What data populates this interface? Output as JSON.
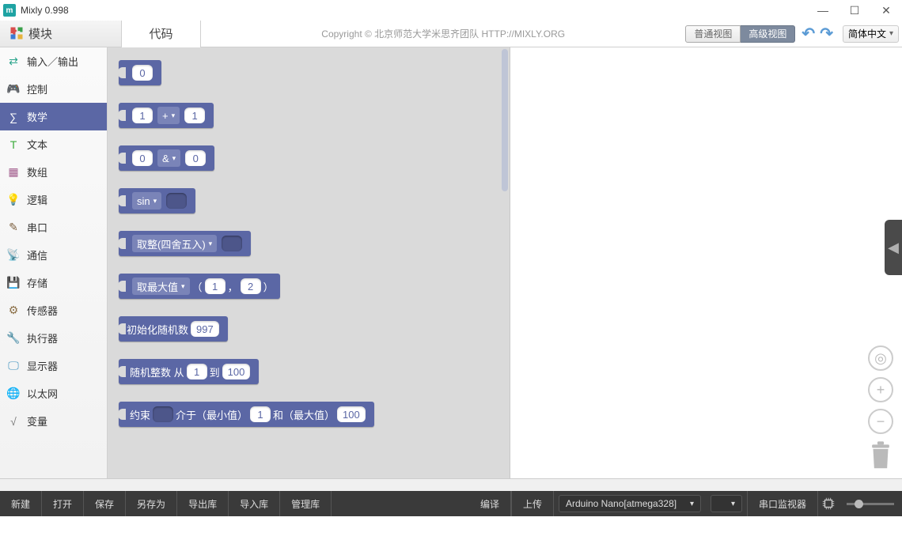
{
  "window": {
    "title": "Mixly 0.998"
  },
  "tabs": {
    "blocks": "模块",
    "code": "代码"
  },
  "copyright": "Copyright © 北京师范大学米思齐团队 HTTP://MIXLY.ORG",
  "view": {
    "normal": "普通视图",
    "advanced": "高级视图"
  },
  "language": "简体中文",
  "categories": [
    {
      "id": "io",
      "label": "输入／输出",
      "color": "#2ca58d"
    },
    {
      "id": "control",
      "label": "控制",
      "color": "#4aa14a"
    },
    {
      "id": "math",
      "label": "数学",
      "color": "#5b67a5",
      "active": true
    },
    {
      "id": "text",
      "label": "文本",
      "color": "#3bab3b"
    },
    {
      "id": "array",
      "label": "数组",
      "color": "#a15b8c"
    },
    {
      "id": "logic",
      "label": "逻辑",
      "color": "#3f82d6"
    },
    {
      "id": "serial",
      "label": "串口",
      "color": "#7b5e3d"
    },
    {
      "id": "comm",
      "label": "通信",
      "color": "#3aa072"
    },
    {
      "id": "storage",
      "label": "存储",
      "color": "#b34848"
    },
    {
      "id": "sensor",
      "label": "传感器",
      "color": "#8a6e45"
    },
    {
      "id": "actuator",
      "label": "执行器",
      "color": "#4a9b6a"
    },
    {
      "id": "display",
      "label": "显示器",
      "color": "#3b8fbd"
    },
    {
      "id": "ethernet",
      "label": "以太网",
      "color": "#b55757"
    },
    {
      "id": "variable",
      "label": "变量",
      "color": "#7a7a7a"
    }
  ],
  "blocks": {
    "num0": "0",
    "addL": "1",
    "addOp": "+",
    "addR": "1",
    "bitL": "0",
    "bitOp": "&",
    "bitR": "0",
    "trig": "sin",
    "round": "取整(四舍五入)",
    "max": "取最大值",
    "maxA": "1",
    "maxB": "2",
    "initRand": "初始化随机数",
    "seed": "997",
    "randInt": "随机整数",
    "from": "从",
    "to": "到",
    "randA": "1",
    "randB": "100",
    "constrain": "约束",
    "between": "介于（最小值）",
    "and": "和（最大值）",
    "conA": "1",
    "conB": "100"
  },
  "bottom": {
    "new": "新建",
    "open": "打开",
    "save": "保存",
    "saveas": "另存为",
    "exportlib": "导出库",
    "importlib": "导入库",
    "managelib": "管理库",
    "compile": "编译",
    "upload": "上传",
    "board": "Arduino Nano[atmega328]",
    "monitor": "串口监视器"
  }
}
